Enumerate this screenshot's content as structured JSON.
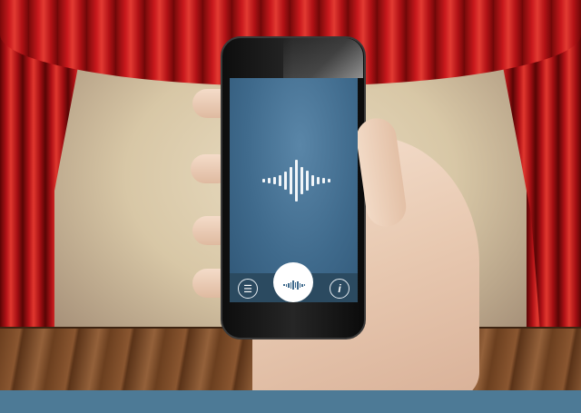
{
  "scene": {
    "description_colors": {
      "curtain": "#c8181c",
      "footer_bar": "#4d7a96",
      "screen_bg": "#3f6a8c"
    }
  },
  "app": {
    "icons": {
      "list": "list-icon",
      "info": "info-icon",
      "waveform": "waveform-icon",
      "record": "record-waveform-icon"
    },
    "list_glyph": "☰",
    "info_glyph": "i"
  }
}
